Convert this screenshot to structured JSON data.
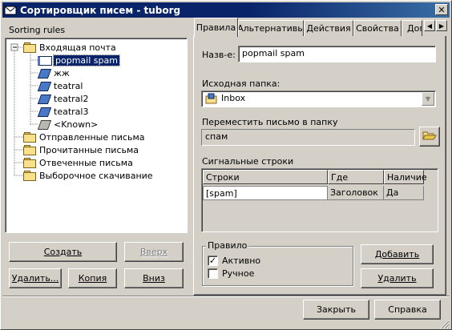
{
  "window": {
    "title": "Сортировщик писем - tuborg",
    "close_glyph": "✕"
  },
  "left": {
    "sorting_rules_label": "Sorting rules",
    "tree": {
      "inbox": "Входящая почта",
      "inbox_children": [
        "popmail spam",
        "жж",
        "teatral",
        "teatral2",
        "teatral3",
        "<Known>"
      ],
      "selected": "popmail spam",
      "folders": [
        "Отправленные письма",
        "Прочитанные письма",
        "Отвеченные письма",
        "Выборочное скачивание"
      ]
    },
    "buttons": {
      "create": "Создать",
      "up": "Вверх",
      "delete": "Удалить...",
      "copy": "Копия",
      "down": "Вниз"
    }
  },
  "tabs": [
    "Правила",
    "Альтернативы",
    "Действия",
    "Свойства",
    "Доп"
  ],
  "rules": {
    "name_label": "Назв-е:",
    "name_value": "popmail spam",
    "source_label": "Исходная папка:",
    "source_value": "Inbox",
    "move_label": "Переместить письмо в папку",
    "move_value": "спам",
    "signal_label": "Сигнальные строки",
    "columns": [
      "Строки",
      "Где",
      "Наличие"
    ],
    "rows": [
      [
        "[spam]",
        "Заголовок",
        "Да"
      ]
    ],
    "rule_group": "Правило",
    "active_label": "Активно",
    "active_checked": true,
    "manual_label": "Ручное",
    "manual_checked": false,
    "add_button": "Добавить",
    "delete_button": "Удалить"
  },
  "footer": {
    "close": "Закрыть",
    "help": "Справка"
  }
}
